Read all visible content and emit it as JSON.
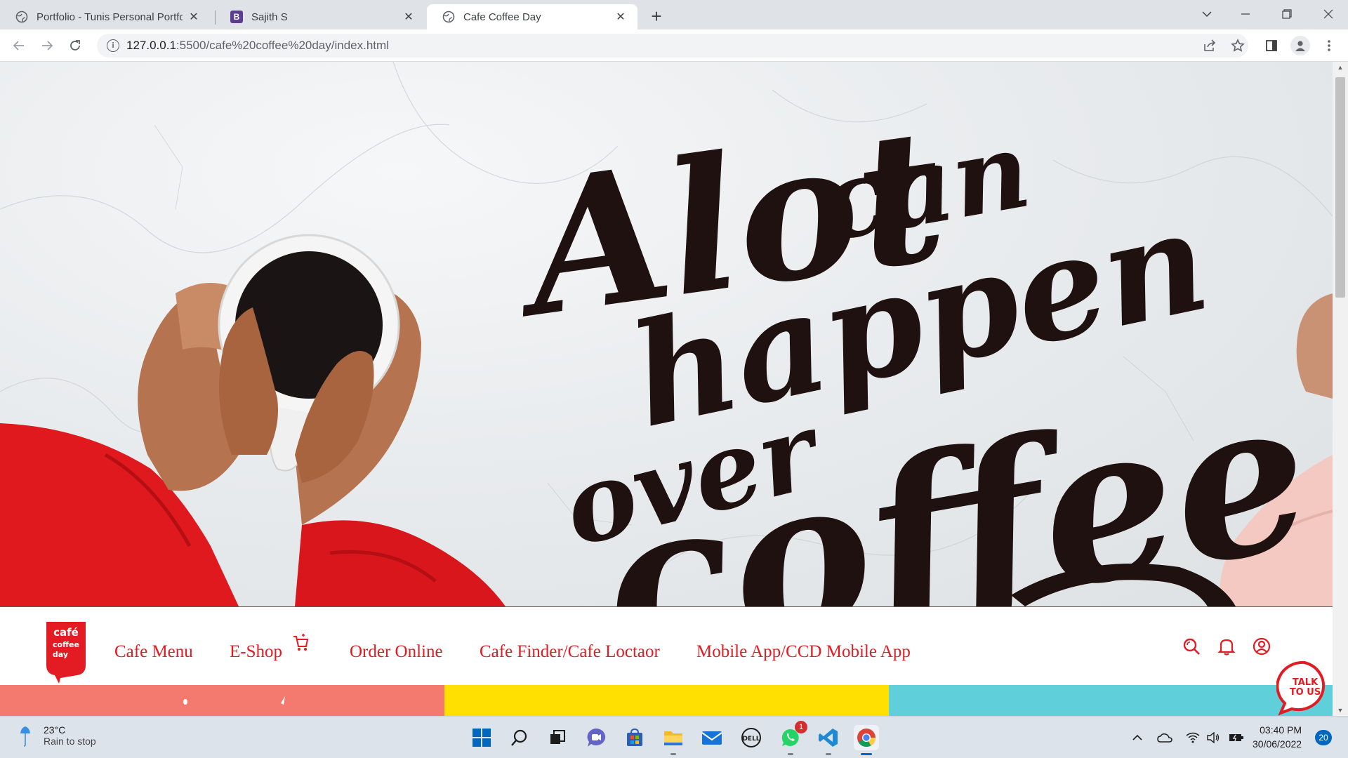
{
  "browser": {
    "tabs": [
      {
        "title": "Portfolio - Tunis Personal Portfolio",
        "favicon": "globe-icon",
        "active": false
      },
      {
        "title": "Sajith S",
        "favicon": "bootstrap-icon",
        "favicon_letter": "B",
        "active": false
      },
      {
        "title": "Cafe Coffee Day",
        "favicon": "globe-icon",
        "active": true
      }
    ],
    "new_tab": "+",
    "url_host": "127.0.0.1",
    "url_path": ":5500/cafe%20coffee%20day/index.html"
  },
  "hero": {
    "headline_line1": "Alot",
    "headline_line2": "can",
    "headline_line3": "happen",
    "headline_line4": "over",
    "headline_line5": "coffee",
    "ink_color": "#1e1110",
    "sleeve_color": "#e0191f"
  },
  "site_nav": {
    "logo_text": [
      "café",
      "coffee",
      "day"
    ],
    "links": [
      {
        "label": "Cafe Menu"
      },
      {
        "label": "E-Shop"
      },
      {
        "label": "Order Online"
      },
      {
        "label": "Cafe Finder/Cafe Loctaor"
      },
      {
        "label": "Mobile App/CCD Mobile App"
      }
    ],
    "icons": [
      "search-icon",
      "bell-icon",
      "user-icon"
    ],
    "accent_color": "#e31b23"
  },
  "color_stripes": [
    "#f47a70",
    "#ffe000",
    "#5fd0da"
  ],
  "talk_button": {
    "line1": "TALK",
    "line2": "TO US"
  },
  "taskbar": {
    "weather_temp": "23°C",
    "weather_text": "Rain to stop",
    "whatsapp_badge": "1",
    "time": "03:40 PM",
    "date": "30/06/2022",
    "notification_count": "20"
  }
}
